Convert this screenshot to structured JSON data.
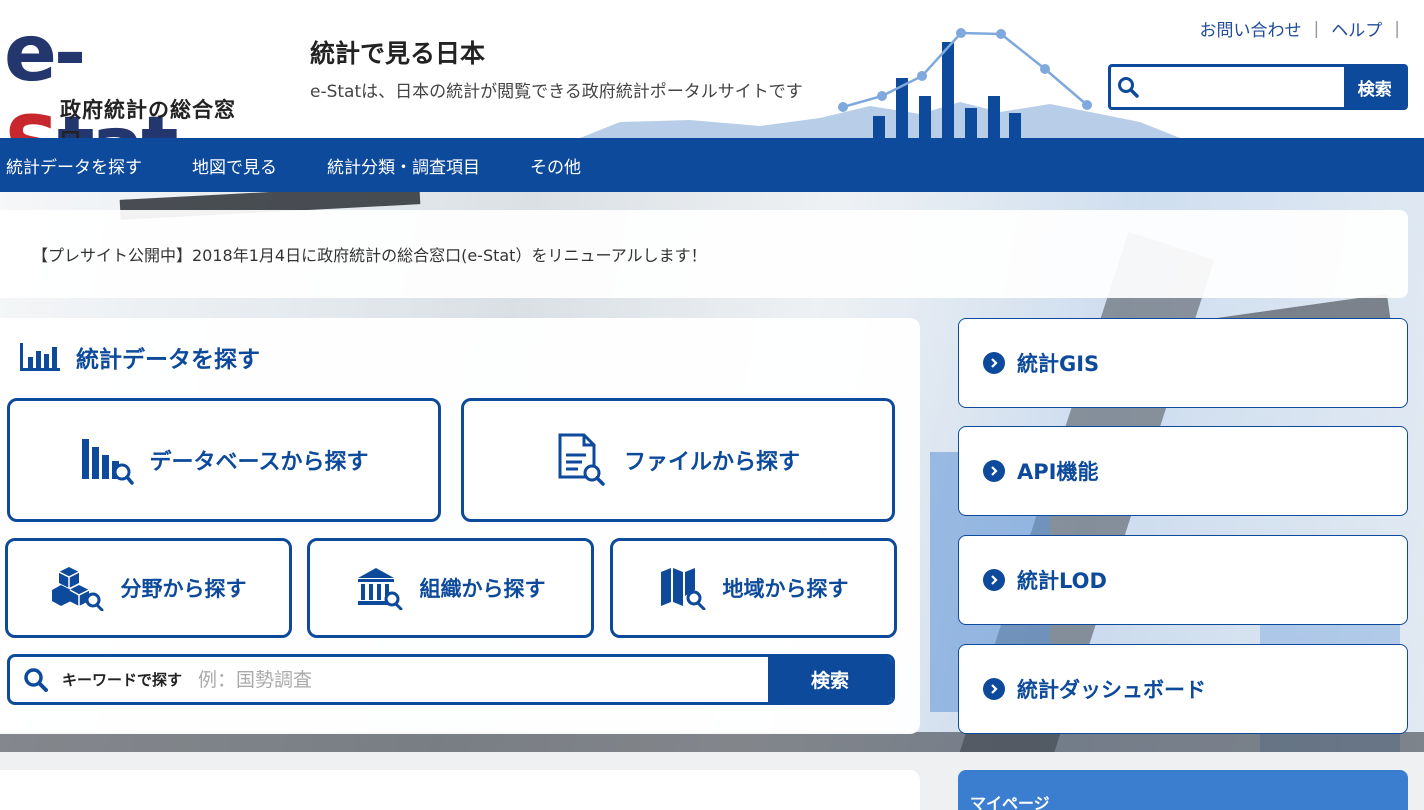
{
  "header": {
    "logo_main_prefix": "e-",
    "logo_main_s": "S",
    "logo_main_suffix": "tat",
    "logo_sub": "政府統計の総合窓口",
    "site_title": "統計で見る日本",
    "site_desc": "e-Statは、日本の統計が閲覧できる政府統計ポータルサイトです",
    "util_links": [
      "お問い合わせ",
      "ヘルプ"
    ],
    "search": {
      "value": "",
      "button_label": "検索",
      "icon": "search-icon"
    }
  },
  "nav": {
    "items": [
      "統計データを探す",
      "地図で見る",
      "統計分類・調査項目",
      "その他"
    ]
  },
  "announcement": "【プレサイト公開中】2018年1月4日に政府統計の総合窓口(e-Stat）をリニューアルします！",
  "main": {
    "panel_title": "統計データを探す",
    "panel_icon": "bar-chart-icon",
    "large_buttons": [
      {
        "label": "データベースから探す",
        "icon": "database-search-icon"
      },
      {
        "label": "ファイルから探す",
        "icon": "file-search-icon"
      }
    ],
    "medium_buttons": [
      {
        "label": "分野から探す",
        "icon": "cubes-search-icon"
      },
      {
        "label": "組織から探す",
        "icon": "building-search-icon"
      },
      {
        "label": "地域から探す",
        "icon": "map-search-icon"
      }
    ],
    "keyword_search": {
      "label": "キーワードで探す",
      "placeholder": "例：国勢調査",
      "button_label": "検索",
      "icon": "search-icon"
    }
  },
  "side_links": [
    {
      "label": "統計GIS"
    },
    {
      "label": "API機能"
    },
    {
      "label": "統計LOD"
    },
    {
      "label": "統計ダッシュボード"
    }
  ],
  "mypage": {
    "label": "マイページ"
  },
  "colors": {
    "primary": "#0d4a9b",
    "logo_navy": "#23376e",
    "logo_red": "#c8282d",
    "accent_light": "#3b7ed0"
  }
}
